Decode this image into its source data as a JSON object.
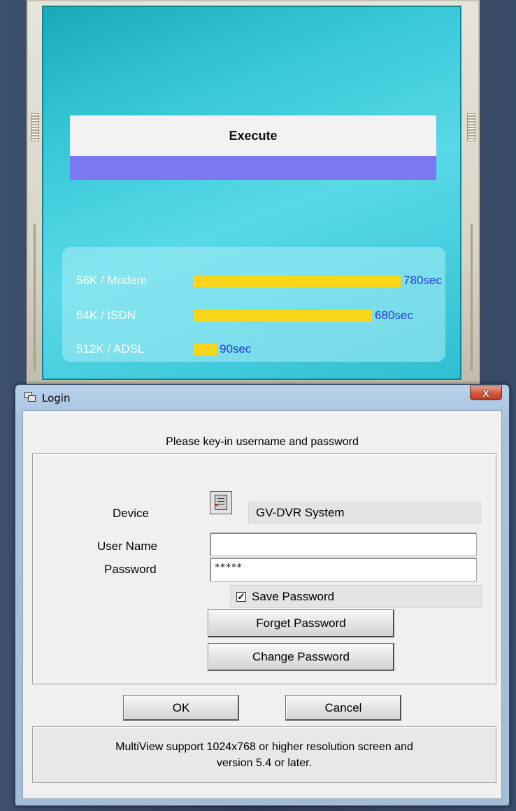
{
  "background_app": {
    "execute_label": "Execute",
    "speeds": [
      {
        "label": "56K / Modem",
        "value": "780sec"
      },
      {
        "label": "64K / ISDN",
        "value": "680sec"
      },
      {
        "label": "512K / ADSL",
        "value": "90sec"
      }
    ],
    "colors": {
      "bar": "#f7d61c",
      "value_text": "#2b3bd8",
      "execute_progress": "#7b78f2"
    }
  },
  "login": {
    "title": "Login",
    "close_label": "X",
    "prompt": "Please key-in username and password",
    "device_label": "Device",
    "device_value": "GV-DVR System",
    "username_label": "User Name",
    "username_value": "",
    "password_label": "Password",
    "password_value": "*****",
    "save_password_label": "Save Password",
    "save_password_checked": true,
    "forget_password_label": "Forget Password",
    "change_password_label": "Change Password",
    "ok_label": "OK",
    "cancel_label": "Cancel",
    "info_line1": "MultiView support 1024x768 or higher resolution screen and",
    "info_line2": "version 5.4 or later."
  }
}
